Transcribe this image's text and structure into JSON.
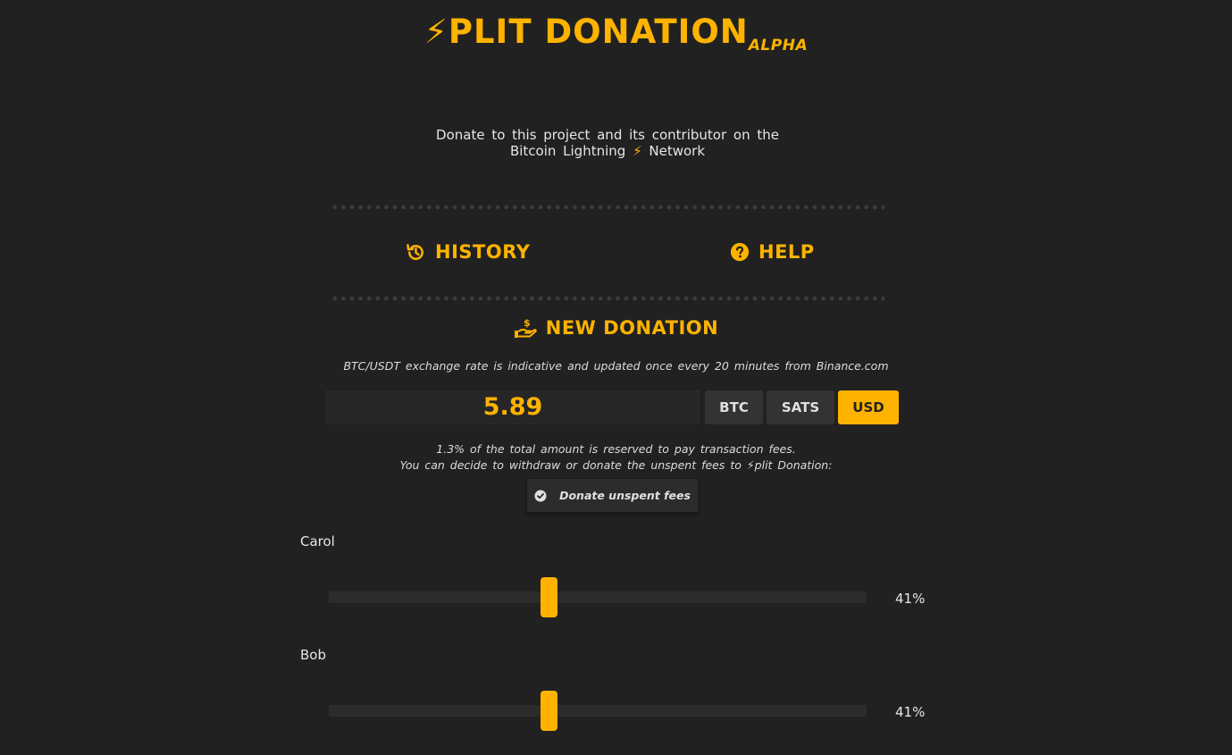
{
  "header": {
    "bolt": "⚡",
    "title": "PLIT DONATION",
    "badge": "ALPHA"
  },
  "tagline": {
    "line1": "Donate to this project and its contributor on the",
    "line2_before": "Bitcoin Lightning",
    "bolt": "⚡",
    "line2_after": "Network"
  },
  "nav": {
    "history_label": "HISTORY",
    "help_label": "HELP",
    "history_icon": "history-icon",
    "help_icon": "help-circle-icon"
  },
  "donation": {
    "title": "NEW DONATION",
    "title_icon": "hand-dollar-icon",
    "rate_note": "BTC/USDT exchange rate is indicative and updated once every 20 minutes from Binance.com",
    "amount": "5.89",
    "units": [
      {
        "label": "BTC",
        "active": false
      },
      {
        "label": "SATS",
        "active": false
      },
      {
        "label": "USD",
        "active": true
      }
    ],
    "fee_note_line1": "1.3% of the total amount is reserved to pay transaction fees.",
    "fee_note_line2": "You can decide to withdraw or donate the unspent fees to ⚡plit Donation:",
    "donate_fees_label": "Donate unspent fees",
    "donate_fees_checked": true
  },
  "contributors": [
    {
      "name": "Carol",
      "percent_label": "41%",
      "percent": 41
    },
    {
      "name": "Bob",
      "percent_label": "41%",
      "percent": 41
    }
  ],
  "colors": {
    "accent": "#ffb300",
    "background": "#212121",
    "button": "#333333"
  }
}
